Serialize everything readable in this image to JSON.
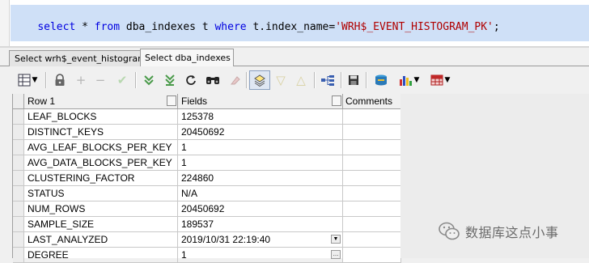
{
  "editor": {
    "sql_tokens": [
      {
        "text": "select",
        "kind": "kw"
      },
      {
        "text": " * ",
        "kind": "op"
      },
      {
        "text": "from",
        "kind": "kw"
      },
      {
        "text": " dba_indexes t ",
        "kind": "op"
      },
      {
        "text": "where",
        "kind": "kw"
      },
      {
        "text": " t.index_name=",
        "kind": "op"
      },
      {
        "text": "'WRH$_EVENT_HISTOGRAM_PK'",
        "kind": "str"
      },
      {
        "text": ";",
        "kind": "op"
      }
    ]
  },
  "tabs": [
    {
      "label": "Select wrh$_event_histogram"
    },
    {
      "label": "Select dba_indexes"
    }
  ],
  "toolbar": {
    "icons": [
      "grid-layout-icon",
      "lock-icon",
      "plus-icon",
      "minus-icon",
      "check-icon",
      "fetch-next-icon",
      "fetch-all-icon",
      "refresh-icon",
      "find-icon",
      "clear-icon",
      "single-record-view-icon",
      "filter-down-icon",
      "filter-up-icon",
      "query-tree-icon",
      "save-icon",
      "export-icon",
      "chart-icon",
      "table-export-icon"
    ]
  },
  "grid": {
    "headers": {
      "col1": "Row 1",
      "col2": "Fields",
      "col3": "Comments"
    },
    "rows": [
      {
        "field": "LEAF_BLOCKS",
        "value": "125378",
        "comment": ""
      },
      {
        "field": "DISTINCT_KEYS",
        "value": "20450692",
        "comment": ""
      },
      {
        "field": "AVG_LEAF_BLOCKS_PER_KEY",
        "value": "1",
        "comment": ""
      },
      {
        "field": "AVG_DATA_BLOCKS_PER_KEY",
        "value": "1",
        "comment": ""
      },
      {
        "field": "CLUSTERING_FACTOR",
        "value": "224860",
        "comment": ""
      },
      {
        "field": "STATUS",
        "value": "N/A",
        "comment": ""
      },
      {
        "field": "NUM_ROWS",
        "value": "20450692",
        "comment": ""
      },
      {
        "field": "SAMPLE_SIZE",
        "value": "189537",
        "comment": ""
      },
      {
        "field": "LAST_ANALYZED",
        "value": "2019/10/31 22:19:40",
        "comment": ""
      },
      {
        "field": "DEGREE",
        "value": "1",
        "comment": ""
      }
    ]
  },
  "watermark": {
    "text": "数据库这点小事"
  },
  "colors": {
    "selection": "#cfe0f7",
    "keyword": "#0000e0",
    "string": "#b00000"
  }
}
